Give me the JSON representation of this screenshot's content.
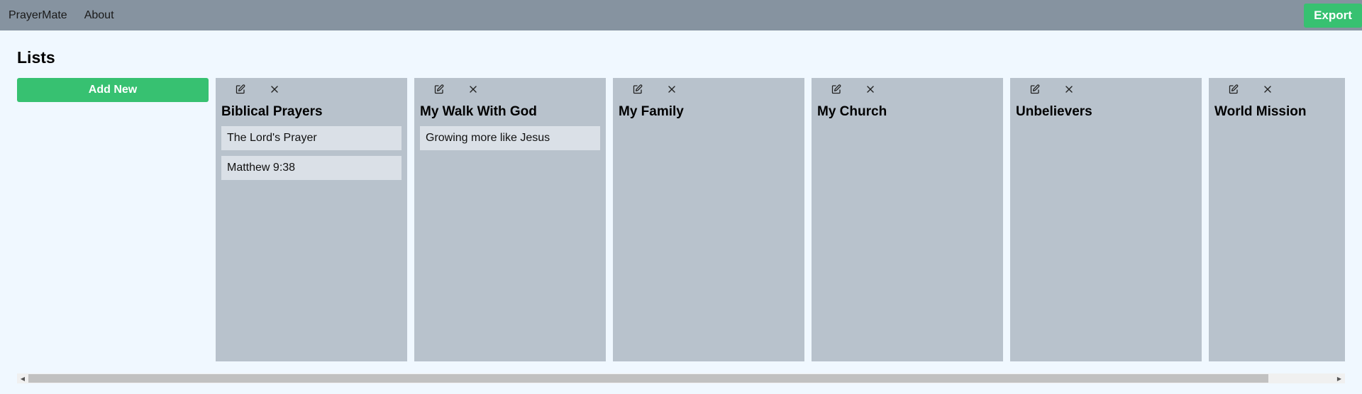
{
  "nav": {
    "brand": "PrayerMate",
    "about": "About",
    "export_label": "Export"
  },
  "page": {
    "title": "Lists",
    "add_label": "Add New"
  },
  "lists": [
    {
      "title": "Biblical Prayers",
      "items": [
        "The Lord's Prayer",
        "Matthew 9:38"
      ]
    },
    {
      "title": "My Walk With God",
      "items": [
        "Growing more like Jesus"
      ]
    },
    {
      "title": "My Family",
      "items": []
    },
    {
      "title": "My Church",
      "items": []
    },
    {
      "title": "Unbelievers",
      "items": []
    },
    {
      "title": "World Mission",
      "items": []
    }
  ],
  "icons": {
    "edit": "edit-icon",
    "delete": "close-icon"
  },
  "scrollbar": {
    "visible_fraction": 0.95,
    "position_fraction": 0.0
  },
  "colors": {
    "topbar": "#8693a0",
    "accent": "#37c171",
    "card": "#b8c2cc",
    "item": "#dae0e7",
    "background": "#f0f8ff"
  }
}
